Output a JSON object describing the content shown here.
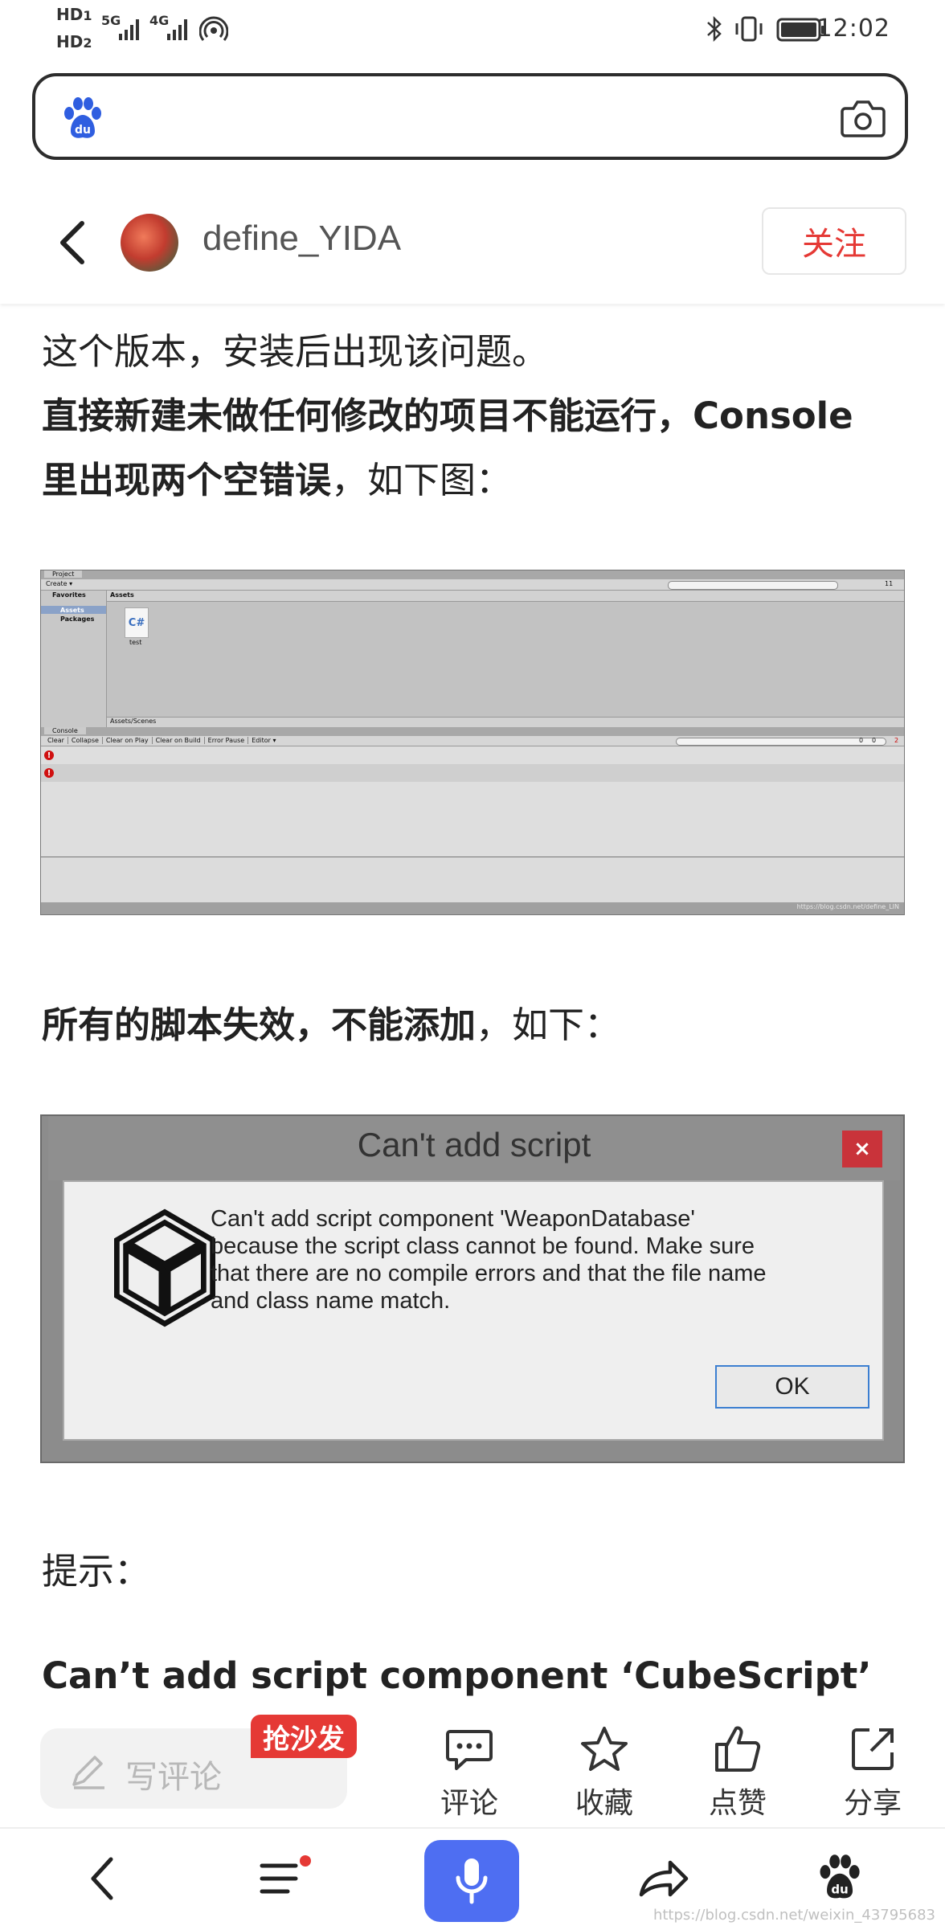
{
  "status_bar": {
    "hd1": "HD",
    "hd1_sub": "1",
    "hd2": "HD",
    "hd2_sub": "2",
    "net1": "5G",
    "net2": "4G",
    "time": "12:02"
  },
  "author": {
    "name": "define_YIDA",
    "follow_label": "关注"
  },
  "article": {
    "line_partial": "",
    "line1": "这个版本，安装后出现该问题。",
    "line2_bold": "直接新建未做任何修改的项目不能运行，Console",
    "line3_bold": "里出现两个空错误",
    "line3_rest": "，如下图：",
    "line4_bold": "所有的脚本失效，不能添加",
    "line4_rest": "，如下：",
    "line5": "提示：",
    "line6_bold": "Can’t add script component ‘CubeScript’"
  },
  "unity_project": {
    "project_tab": "Project",
    "create_menu": "Create ▾",
    "favorites": "Favorites",
    "assets_tree": "Assets",
    "packages_tree": "Packages",
    "assets_header": "Assets",
    "file_icon_text": "C#",
    "file_name": "test",
    "path": "Assets/Scenes",
    "counter": "11",
    "console_tab": "Console",
    "console_buttons": [
      "Clear",
      "Collapse",
      "Clear on Play",
      "Clear on Build",
      "Error Pause",
      "Editor ▾"
    ],
    "console_counts": [
      "0",
      "0",
      "2"
    ],
    "watermark": "https://blog.csdn.net/define_LIN"
  },
  "unity_dialog": {
    "title": "Can't add script",
    "close": "×",
    "message_lines": [
      "Can't add script component 'WeaponDatabase'",
      "because the script class cannot be found. Make sure",
      "that there are no compile errors and that the file name",
      "and class name match."
    ],
    "ok_label": "OK"
  },
  "action_bar": {
    "comment_placeholder": "写评论",
    "sofa_badge": "抢沙发",
    "comment_label": "评论",
    "favorite_label": "收藏",
    "like_label": "点赞",
    "share_label": "分享"
  },
  "footer": {
    "watermark": "https://blog.csdn.net/weixin_43795683"
  },
  "colors": {
    "brand_blue": "#4e6ef2",
    "follow_red": "#e53935",
    "notification_dot": "#e53935"
  },
  "icons": [
    "baidu-paw-icon",
    "camera-icon",
    "back-arrow-icon",
    "pencil-icon",
    "comment-icon",
    "star-icon",
    "thumbs-up-icon",
    "share-icon",
    "menu-icon",
    "microphone-icon",
    "forward-icon"
  ]
}
